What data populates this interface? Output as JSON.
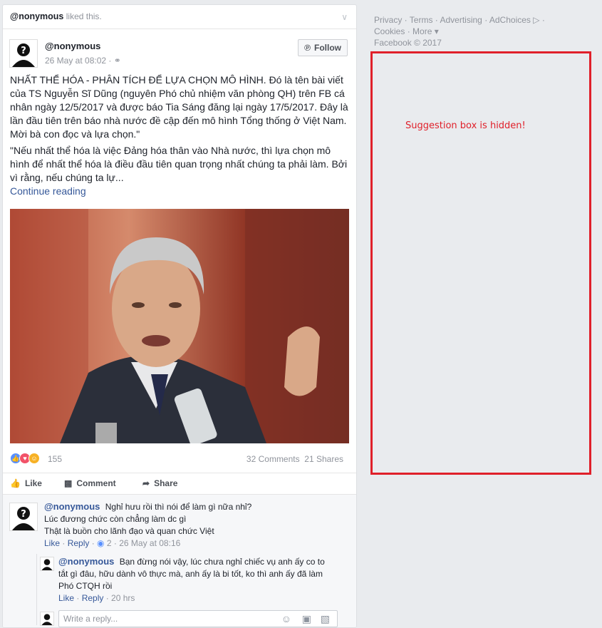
{
  "liked": {
    "user": "@nonymous",
    "suffix": "liked this."
  },
  "post": {
    "author": "@nonymous",
    "time": "26 May at 08:02",
    "follow_label": "Follow",
    "para1": "NHẤT THỂ HÓA - PHÂN TÍCH ĐỂ LỰA CHỌN MÔ HÌNH. Đó là tên bài viết của TS Nguyễn Sĩ Dũng (nguyên Phó chủ nhiệm văn phòng QH) trên FB cá nhân ngày 12/5/2017 và được báo Tia Sáng đăng lại ngày 17/5/2017. Đây là lần đầu tiên trên báo nhà nước đề cập đến mô hình Tổng thống ở Việt Nam. Mời bà con đọc và lựa chọn.\"",
    "para2": "\"Nếu nhất thể hóa là việc Đảng hóa thân vào Nhà nước, thì lựa chọn mô hình để nhất thể hóa là điều đầu tiên quan trọng nhất chúng ta phải làm. Bởi vì rằng, nếu chúng ta lự...",
    "continue": "Continue reading",
    "reaction_count": "155",
    "comments_count": "32 Comments",
    "shares_count": "21 Shares",
    "actions": {
      "like": "Like",
      "comment": "Comment",
      "share": "Share"
    }
  },
  "comments": [
    {
      "user": "@nonymous",
      "lines": [
        "Nghỉ hưu rồi thì nói để làm gì nữa nhỉ?",
        "Lúc đương chức còn chẳng làm dc gì",
        "Thật là buồn cho lãnh đạo và quan chức Việt"
      ],
      "like": "Like",
      "reply": "Reply",
      "likes": "2",
      "time": "26 May at 08:16"
    },
    {
      "user": "@nonymous",
      "lines": [
        "Bạn đừng nói vậy, lúc chưa nghỉ chiếc vụ anh ấy co to",
        "tắt gì đâu, hữu dành vô thực mà, anh ấy là bi tốt, ko thì anh ấy đã làm",
        "Phó CTQH rồi"
      ],
      "like": "Like",
      "reply": "Reply",
      "time": "20 hrs"
    }
  ],
  "reply_placeholder": "Write a reply...",
  "footer": {
    "privacy": "Privacy",
    "terms": "Terms",
    "advertising": "Advertising",
    "adchoices": "AdChoices",
    "cookies": "Cookies",
    "more": "More",
    "copyright": "Facebook © 2017"
  },
  "annotation": "Suggestion box is hidden!",
  "colors": {
    "accent": "#365899",
    "annotation_red": "#e0202a"
  }
}
